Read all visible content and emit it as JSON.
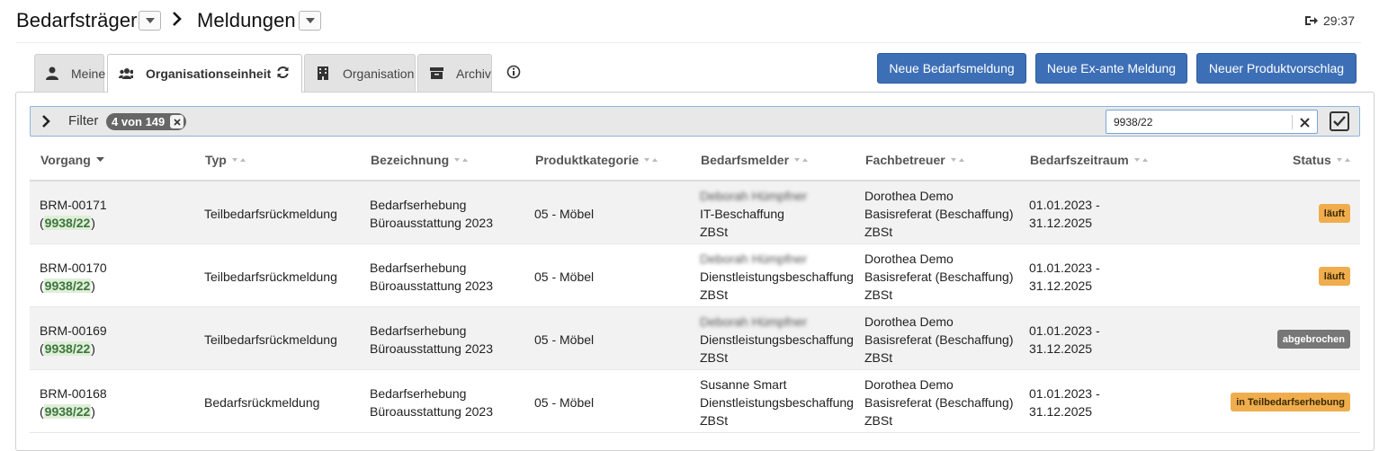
{
  "breadcrumb": {
    "first": "Bedarfsträger",
    "second": "Meldungen"
  },
  "session": {
    "timer": "29:37"
  },
  "tabs": [
    {
      "label": "Meine",
      "icon": "user-icon"
    },
    {
      "label": "Organisationseinheit",
      "icon": "users-icon",
      "active": true
    },
    {
      "label": "Organisation",
      "icon": "building-icon"
    },
    {
      "label": "Archiv",
      "icon": "archive-icon"
    }
  ],
  "actions": {
    "new_demand": "Neue Bedarfsmeldung",
    "new_exante": "Neue Ex-ante Meldung",
    "new_product": "Neuer Produktvorschlag"
  },
  "filter": {
    "label": "Filter",
    "chip": "4 von 149",
    "search_value": "9938/22"
  },
  "table": {
    "columns": [
      "Vorgang",
      "Typ",
      "Bezeichnung",
      "Produktkategorie",
      "Bedarfsmelder",
      "Fachbetreuer",
      "Bedarfszeitraum",
      "Status"
    ],
    "rows": [
      {
        "id": "BRM-00171",
        "ref": "9938/22",
        "typ": "Teilbedarfsrückmeldung",
        "bez1": "Bedarfserhebung",
        "bez2": "Büroausstattung 2023",
        "kat": "05 - Möbel",
        "melder1": "Deborah Hümpfner",
        "melder2": "IT-Beschaffung",
        "melder3": "ZBSt",
        "fach1": "Dorothea Demo",
        "fach2": "Basisreferat (Beschaffung)",
        "fach3": "ZBSt",
        "zeit1": "01.01.2023 -",
        "zeit2": "31.12.2025",
        "status": "läuft"
      },
      {
        "id": "BRM-00170",
        "ref": "9938/22",
        "typ": "Teilbedarfsrückmeldung",
        "bez1": "Bedarfserhebung",
        "bez2": "Büroausstattung 2023",
        "kat": "05 - Möbel",
        "melder1": "Deborah Hümpfner",
        "melder2": "Dienstleistungsbeschaffung",
        "melder3": "ZBSt",
        "fach1": "Dorothea Demo",
        "fach2": "Basisreferat (Beschaffung)",
        "fach3": "ZBSt",
        "zeit1": "01.01.2023 -",
        "zeit2": "31.12.2025",
        "status": "läuft"
      },
      {
        "id": "BRM-00169",
        "ref": "9938/22",
        "typ": "Teilbedarfsrückmeldung",
        "bez1": "Bedarfserhebung",
        "bez2": "Büroausstattung 2023",
        "kat": "05 - Möbel",
        "melder1": "Deborah Hümpfner",
        "melder2": "Dienstleistungsbeschaffung",
        "melder3": "ZBSt",
        "fach1": "Dorothea Demo",
        "fach2": "Basisreferat (Beschaffung)",
        "fach3": "ZBSt",
        "zeit1": "01.01.2023 -",
        "zeit2": "31.12.2025",
        "status": "abgebrochen"
      },
      {
        "id": "BRM-00168",
        "ref": "9938/22",
        "typ": "Bedarfsrückmeldung",
        "bez1": "Bedarfserhebung",
        "bez2": "Büroausstattung 2023",
        "kat": "05 - Möbel",
        "melder1": "Susanne Smart",
        "melder2": "Dienstleistungsbeschaffung",
        "melder3": "ZBSt",
        "fach1": "Dorothea Demo",
        "fach2": "Basisreferat (Beschaffung)",
        "fach3": "ZBSt",
        "zeit1": "01.01.2023 -",
        "zeit2": "31.12.2025",
        "status": "in Teilbedarfserhebung"
      }
    ]
  },
  "colors": {
    "primary": "#3d6fb6",
    "status_running": "#f0ad4e",
    "status_cancelled": "#777777",
    "highlight_text": "#3c763d"
  }
}
